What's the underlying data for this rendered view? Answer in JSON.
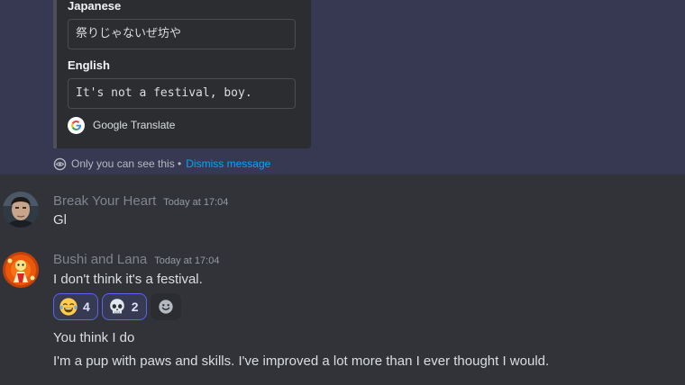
{
  "ephemeral_message": {
    "embed": {
      "field_1_title": "Japanese",
      "field_1_value": "祭りじゃないぜ坊や",
      "field_2_title": "English",
      "field_2_value": "It's not a festival, boy.",
      "footer_text": "Google Translate",
      "footer_icon": "google-g-icon"
    },
    "note_text": "Only you can see this •",
    "dismiss_label": "Dismiss message",
    "note_icon": "eye-icon"
  },
  "messages": [
    {
      "username": "Break Your Heart",
      "timestamp": "Today at 17:04",
      "lines": [
        "Gl"
      ],
      "avatar_icon": "avatar-photo"
    },
    {
      "username": "Bushi and Lana",
      "timestamp": "Today at 17:04",
      "lines": [
        "I don't think it's a festival.",
        "You think I do",
        "I'm a pup with paws and skills. I've improved a lot more than I ever thought I would."
      ],
      "avatar_icon": "avatar-illustration",
      "reactions": [
        {
          "emoji": "joy-emoji",
          "count": "4"
        },
        {
          "emoji": "skull-emoji",
          "count": "2"
        }
      ],
      "add_reaction_icon": "smiley-add-icon"
    }
  ],
  "colors": {
    "background": "#313338",
    "ephemeral_highlight": "#373851",
    "link": "#00a8fc",
    "reaction_border": "#5865f2"
  }
}
